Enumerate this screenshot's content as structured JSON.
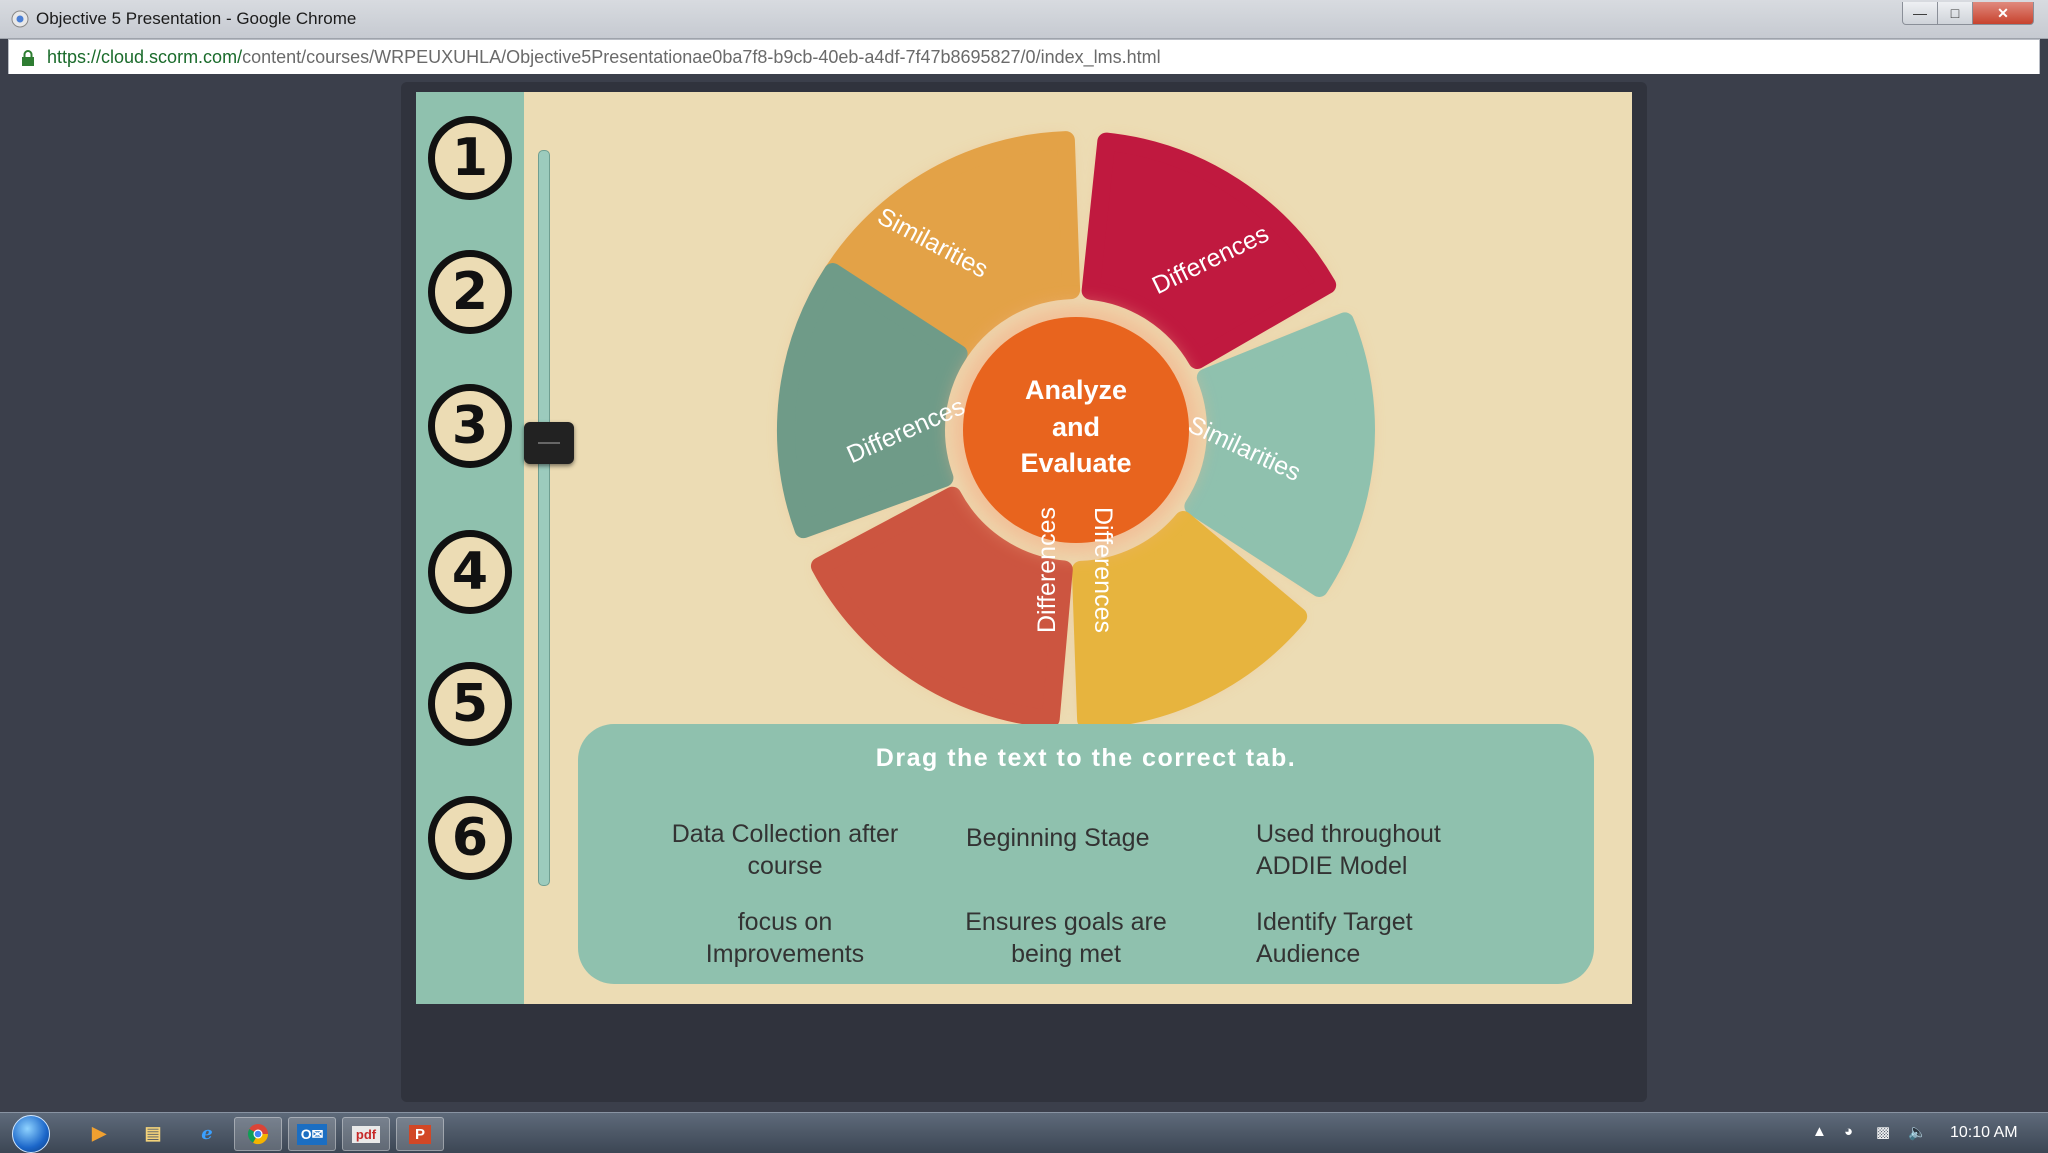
{
  "window": {
    "title": "Objective 5 Presentation - Google Chrome"
  },
  "address_bar": {
    "url_host": "https://cloud.scorm.com/",
    "url_path": "content/courses/WRPEUXUHLA/Objective5Presentationae0ba7f8-b9cb-40eb-a4df-7f47b8695827/0/index_lms.html"
  },
  "slide": {
    "steps": [
      "1",
      "2",
      "3",
      "4",
      "5",
      "6"
    ],
    "slider_position_step": 3,
    "wheel": {
      "center_label_lines": [
        "Analyze",
        "and",
        "Evaluate"
      ],
      "segments": [
        {
          "label": "Similarities",
          "color": "#e3a247"
        },
        {
          "label": "Differences",
          "color": "#c0193f"
        },
        {
          "label": "Similarities",
          "color": "#8fc1ae"
        },
        {
          "label": "Differences",
          "color": "#e7b43e"
        },
        {
          "label": "Differences",
          "color": "#cc5540"
        },
        {
          "label": "Differences",
          "color": "#6f9b88"
        }
      ],
      "center_color": "#e8641e"
    },
    "task": {
      "instruction": "Drag the text to the correct tab.",
      "items": [
        {
          "line1": "Data Collection after",
          "line2": "course"
        },
        {
          "line1": "Beginning Stage",
          "line2": ""
        },
        {
          "line1": "Used throughout",
          "line2": "ADDIE Model"
        },
        {
          "line1": "focus on",
          "line2": "Improvements"
        },
        {
          "line1": "Ensures goals are",
          "line2": "being met"
        },
        {
          "line1": "Identify Target",
          "line2": "Audience"
        }
      ]
    }
  },
  "taskbar": {
    "clock": "10:10 AM",
    "apps": [
      "media-player",
      "file-explorer",
      "internet-explorer",
      "chrome",
      "outlook",
      "acrobat",
      "powerpoint"
    ]
  }
}
